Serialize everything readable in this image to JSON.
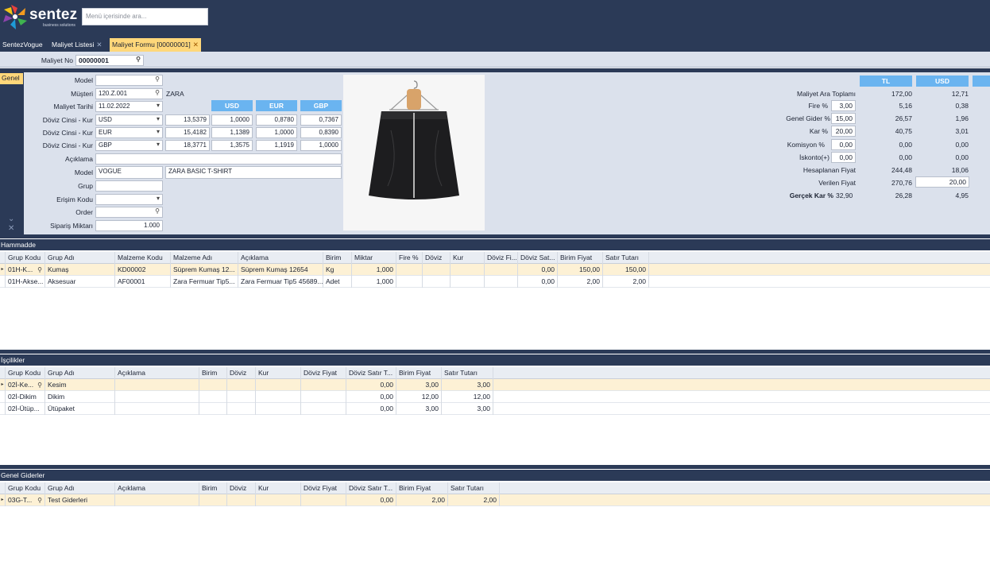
{
  "app": {
    "brand": "sentez",
    "tagline": "business solutions",
    "search_placeholder": "Menü içerisinde ara..."
  },
  "tabs": [
    {
      "label": "SentezVogue"
    },
    {
      "label": "Maliyet Listesi"
    },
    {
      "label": "Maliyet Formu [00000001]"
    }
  ],
  "form": {
    "maliyet_no_label": "Maliyet No",
    "maliyet_no": "00000001",
    "side_tab": "Genel",
    "labels": {
      "model": "Model",
      "musteri": "Müşteri",
      "tarih": "Maliyet Tarihi",
      "doviz1": "Döviz Cinsi - Kur",
      "doviz2": "Döviz Cinsi - Kur",
      "doviz3": "Döviz Cinsi - Kur",
      "aciklama": "Açıklama",
      "model2": "Model",
      "grup": "Grup",
      "erisim": "Erişim Kodu",
      "order": "Order",
      "siparis": "Sipariş Miktarı"
    },
    "model": "",
    "musteri_code": "120.Z.001",
    "musteri_name": "ZARA",
    "tarih": "11.02.2022",
    "fx_headers": [
      "USD",
      "EUR",
      "GBP"
    ],
    "fx_rows": [
      {
        "cur": "USD",
        "rate": "13,5379",
        "v": [
          "1,0000",
          "0,8780",
          "0,7367"
        ]
      },
      {
        "cur": "EUR",
        "rate": "15,4182",
        "v": [
          "1,1389",
          "1,0000",
          "0,8390"
        ]
      },
      {
        "cur": "GBP",
        "rate": "18,3771",
        "v": [
          "1,3575",
          "1,1919",
          "1,0000"
        ]
      }
    ],
    "aciklama": "",
    "model_code": "VOGUE",
    "model_desc": "ZARA BASIC T-SHIRT",
    "grup": "",
    "erisim": "",
    "order": "",
    "siparis": "1.000"
  },
  "summary": {
    "col_headers": [
      "TL",
      "USD"
    ],
    "rows": [
      {
        "label": "Maliyet Ara Toplamı",
        "input": "",
        "tl": "172,00",
        "usd": "12,71"
      },
      {
        "label": "Fire %",
        "input": "3,00",
        "tl": "5,16",
        "usd": "0,38"
      },
      {
        "label": "Genel Gider %",
        "input": "15,00",
        "tl": "26,57",
        "usd": "1,96"
      },
      {
        "label": "Kar %",
        "input": "20,00",
        "tl": "40,75",
        "usd": "3,01"
      },
      {
        "label": "Komisyon %",
        "input": "0,00",
        "tl": "0,00",
        "usd": "0,00"
      },
      {
        "label": "İskonto(+)",
        "input": "0,00",
        "tl": "0,00",
        "usd": "0,00"
      },
      {
        "label": "Hesaplanan Fiyat",
        "input": "",
        "tl": "244,48",
        "usd": "18,06"
      },
      {
        "label": "Verilen Fiyat",
        "input": "",
        "tl": "270,76",
        "usd": "20,00"
      }
    ],
    "gercek_label": "Gerçek Kar %",
    "gercek_val": "32,90",
    "gercek_tl": "26,28",
    "gercek_usd": "4,95"
  },
  "hammadde": {
    "title": "Hammadde",
    "headers": [
      "Grup Kodu",
      "Grup Adı",
      "Malzeme Kodu",
      "Malzeme Adı",
      "Açıklama",
      "Birim",
      "Miktar",
      "Fire %",
      "Döviz",
      "Kur",
      "Döviz Fi...",
      "Döviz Sat...",
      "Birim Fiyat",
      "Satır Tutarı"
    ],
    "rows": [
      [
        "01H-K...",
        "Kumaş",
        "KD00002",
        "Süprem Kumaş 12...",
        "Süprem Kumaş 12654",
        "Kg",
        "1,000",
        "",
        "",
        "",
        "",
        "0,00",
        "150,00",
        "150,00"
      ],
      [
        "01H-Akse...",
        "Aksesuar",
        "AF00001",
        "Zara Fermuar Tip5...",
        "Zara Fermuar Tip5 45689...",
        "Adet",
        "1,000",
        "",
        "",
        "",
        "",
        "0,00",
        "2,00",
        "2,00"
      ]
    ]
  },
  "iscilik": {
    "title": "İşçilikler",
    "headers": [
      "Grup Kodu",
      "Grup Adı",
      "Açıklama",
      "Birim",
      "Döviz",
      "Kur",
      "Döviz Fiyat",
      "Döviz Satır T...",
      "Birim Fiyat",
      "Satır Tutarı"
    ],
    "rows": [
      [
        "02İ-Ke...",
        "Kesim",
        "",
        "",
        "",
        "",
        "",
        "0,00",
        "3,00",
        "3,00"
      ],
      [
        "02İ-Dikim",
        "Dikim",
        "",
        "",
        "",
        "",
        "",
        "0,00",
        "12,00",
        "12,00"
      ],
      [
        "02İ-Ütüp...",
        "Ütüpaket",
        "",
        "",
        "",
        "",
        "",
        "0,00",
        "3,00",
        "3,00"
      ]
    ]
  },
  "genel": {
    "title": "Genel Giderler",
    "headers": [
      "Grup Kodu",
      "Grup Adı",
      "Açıklama",
      "Birim",
      "Döviz",
      "Kur",
      "Döviz Fiyat",
      "Döviz Satır T...",
      "Birim Fiyat",
      "Satır Tutarı"
    ],
    "rows": [
      [
        "03G-T...",
        "Test Giderleri",
        "",
        "",
        "",
        "",
        "",
        "0,00",
        "2,00",
        "2,00"
      ]
    ]
  }
}
